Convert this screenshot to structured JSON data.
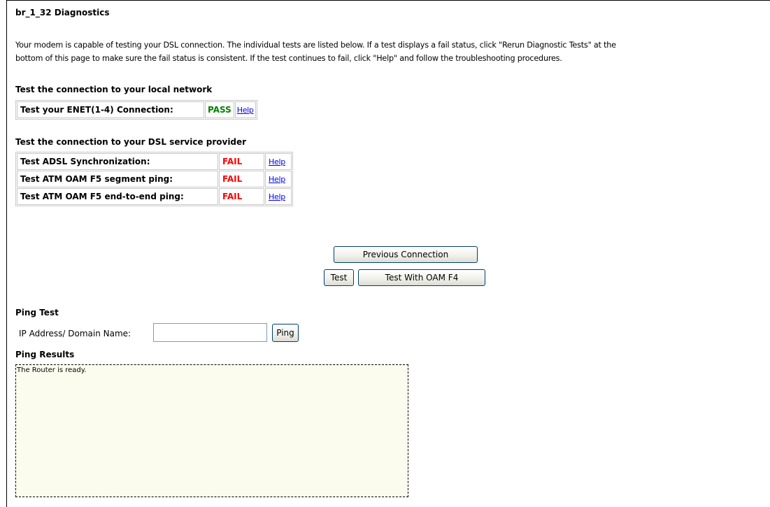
{
  "page": {
    "title": "br_1_32 Diagnostics",
    "intro_line1": "Your modem is capable of testing your DSL connection. The individual tests are listed below. If a test displays a fail status, click \"Rerun Diagnostic Tests\" at the",
    "intro_line2": "bottom of this page to make sure the fail status is consistent. If the test continues to fail, click \"Help\" and follow the troubleshooting procedures."
  },
  "local_network": {
    "heading": "Test the connection to your local network",
    "tests": [
      {
        "label": "Test your ENET(1-4) Connection:",
        "status": "PASS",
        "help": "Help"
      }
    ]
  },
  "dsl_provider": {
    "heading": "Test the connection to your DSL service provider",
    "tests": [
      {
        "label": "Test ADSL Synchronization:",
        "status": "FAIL",
        "help": "Help"
      },
      {
        "label": "Test ATM OAM F5 segment ping:",
        "status": "FAIL",
        "help": "Help"
      },
      {
        "label": "Test ATM OAM F5 end-to-end ping:",
        "status": "FAIL",
        "help": "Help"
      }
    ]
  },
  "buttons": {
    "previous_connection": "Previous Connection",
    "test": "Test",
    "test_oam_f4": "Test With OAM F4"
  },
  "ping": {
    "heading": "Ping Test",
    "label": "IP Address/ Domain Name:",
    "value": "",
    "button": "Ping",
    "results_heading": "Ping Results",
    "results_text": "The Router is ready."
  },
  "colors": {
    "pass": "#008000",
    "fail": "#ff0000",
    "link": "#0000ee",
    "results_bg": "#fcfcee"
  }
}
